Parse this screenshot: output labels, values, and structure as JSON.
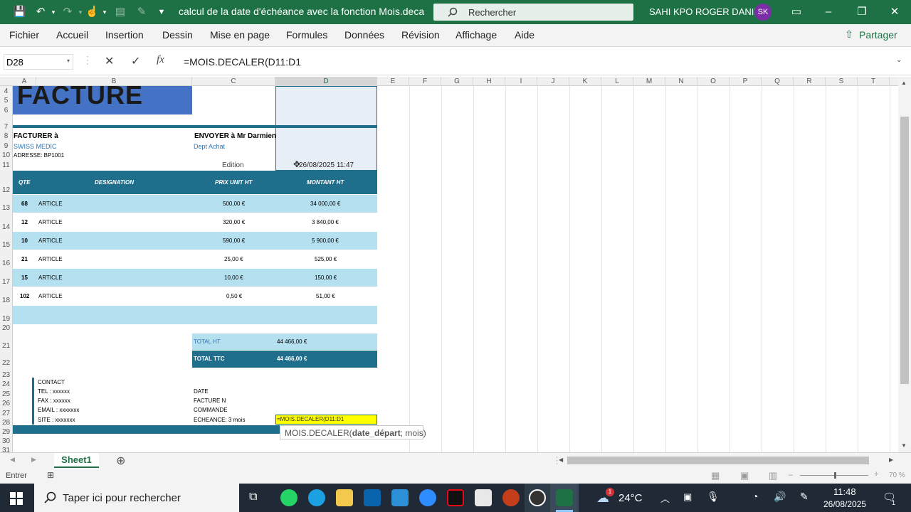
{
  "titlebar": {
    "doc_title": "calcul de la date d'échéance avec la fonction Mois.decaller  -  Ex...",
    "search_placeholder": "Rechercher",
    "user_name": "SAHI KPO ROGER DANIEL",
    "avatar_initials": "SK"
  },
  "ribbon": {
    "tabs": [
      "Fichier",
      "Accueil",
      "Insertion",
      "Dessin",
      "Mise en page",
      "Formules",
      "Données",
      "Révision",
      "Affichage",
      "Aide"
    ],
    "share_label": "Partager"
  },
  "formula_bar": {
    "name_box": "D28",
    "fx": "fx",
    "formula": "=MOIS.DECALER(D11:D1"
  },
  "columns": [
    "A",
    "B",
    "C",
    "D",
    "E",
    "F",
    "G",
    "H",
    "I",
    "J",
    "K",
    "L",
    "M",
    "N",
    "O",
    "P",
    "Q",
    "R",
    "S",
    "T"
  ],
  "rows": [
    "4",
    "5",
    "6",
    "7",
    "8",
    "9",
    "10",
    "11",
    "12",
    "13",
    "14",
    "15",
    "16",
    "17",
    "18",
    "19",
    "20",
    "21",
    "22",
    "23",
    "24",
    "25",
    "26",
    "27",
    "28",
    "29",
    "30",
    "31"
  ],
  "invoice": {
    "title": "FACTURE",
    "bill_to_label": "FACTURER à",
    "bill_to_company": "SWISS MEDIC",
    "bill_to_address": "ADRESSE: BP1001",
    "ship_to_label": "ENVOYER à Mr Darmien",
    "ship_to_dept": "Dept Achat",
    "edition_label": "Edition",
    "edition_value": "26/08/2025 11:47",
    "headers": [
      "QTE",
      "DESIGNATION",
      "PRIX UNIT HT",
      "MONTANT HT"
    ],
    "lines": [
      {
        "qty": "68",
        "designation": "ARTICLE",
        "unit": "500,00 €",
        "amount": "34 000,00 €"
      },
      {
        "qty": "12",
        "designation": "ARTICLE",
        "unit": "320,00 €",
        "amount": "3 840,00 €"
      },
      {
        "qty": "10",
        "designation": "ARTICLE",
        "unit": "590,00 €",
        "amount": "5 900,00 €"
      },
      {
        "qty": "21",
        "designation": "ARTICLE",
        "unit": "25,00 €",
        "amount": "525,00 €"
      },
      {
        "qty": "15",
        "designation": "ARTICLE",
        "unit": "10,00 €",
        "amount": "150,00 €"
      },
      {
        "qty": "102",
        "designation": "ARTICLE",
        "unit": "0,50 €",
        "amount": "51,00 €"
      }
    ],
    "total_ht_label": "TOTAL HT",
    "total_ht_value": "44 466,00 €",
    "total_ttc_label": "TOTAL TTC",
    "total_ttc_value": "44 466,00 €",
    "contact_lines": [
      "CONTACT",
      "TEL : xxxxxx",
      "FAX : xxxxxx",
      "EMAIL : xxxxxxx",
      "SITE : xxxxxxx"
    ],
    "meta_lines": [
      "DATE",
      "FACTURE N",
      "COMMANDE",
      "ECHEANCE: 3 mois"
    ],
    "edit_cell": "=MOIS.DECALER(D11:D1",
    "tooltip_func": "MOIS.DECALER(",
    "tooltip_arg_bold": "date_départ",
    "tooltip_rest": "; mois)"
  },
  "sheet_tab": "Sheet1",
  "status": {
    "mode": "Entrer",
    "zoom": "70 %"
  },
  "taskbar": {
    "search_placeholder": "Taper ici pour rechercher",
    "temperature": "24°C",
    "weather_badge": "1",
    "time": "11:48",
    "date": "26/08/2025",
    "notif_count": "1"
  },
  "colors": {
    "excel_green": "#1e7145",
    "invoice_dark": "#1f6e8c",
    "invoice_light": "#b4e0f0",
    "facture_blue": "#4472c4",
    "edit_yellow": "#ffff00"
  }
}
